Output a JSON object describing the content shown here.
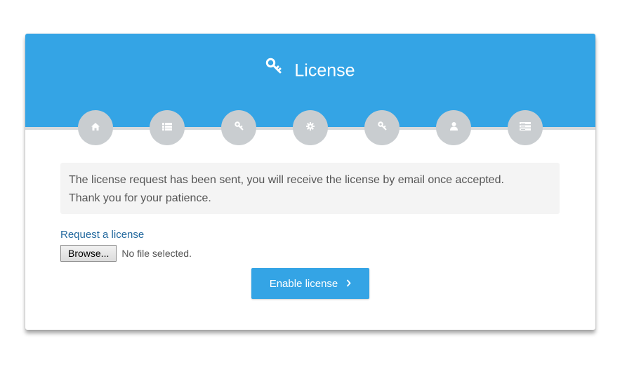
{
  "header": {
    "title": "License",
    "title_icon": "key-icon",
    "background_color": "#34a4e5"
  },
  "steps": [
    {
      "icon": "home-icon"
    },
    {
      "icon": "list-icon"
    },
    {
      "icon": "key-icon"
    },
    {
      "icon": "gear-icon"
    },
    {
      "icon": "key-icon"
    },
    {
      "icon": "user-icon"
    },
    {
      "icon": "server-icon"
    }
  ],
  "notice": {
    "line1": "The license request has been sent, you will receive the license by email once accepted.",
    "line2": "Thank you for your patience."
  },
  "request_link": "Request a license",
  "file_input": {
    "button_label": "Browse...",
    "status": "No file selected."
  },
  "enable_button": {
    "label": "Enable license",
    "icon": "chevron-right-icon"
  }
}
